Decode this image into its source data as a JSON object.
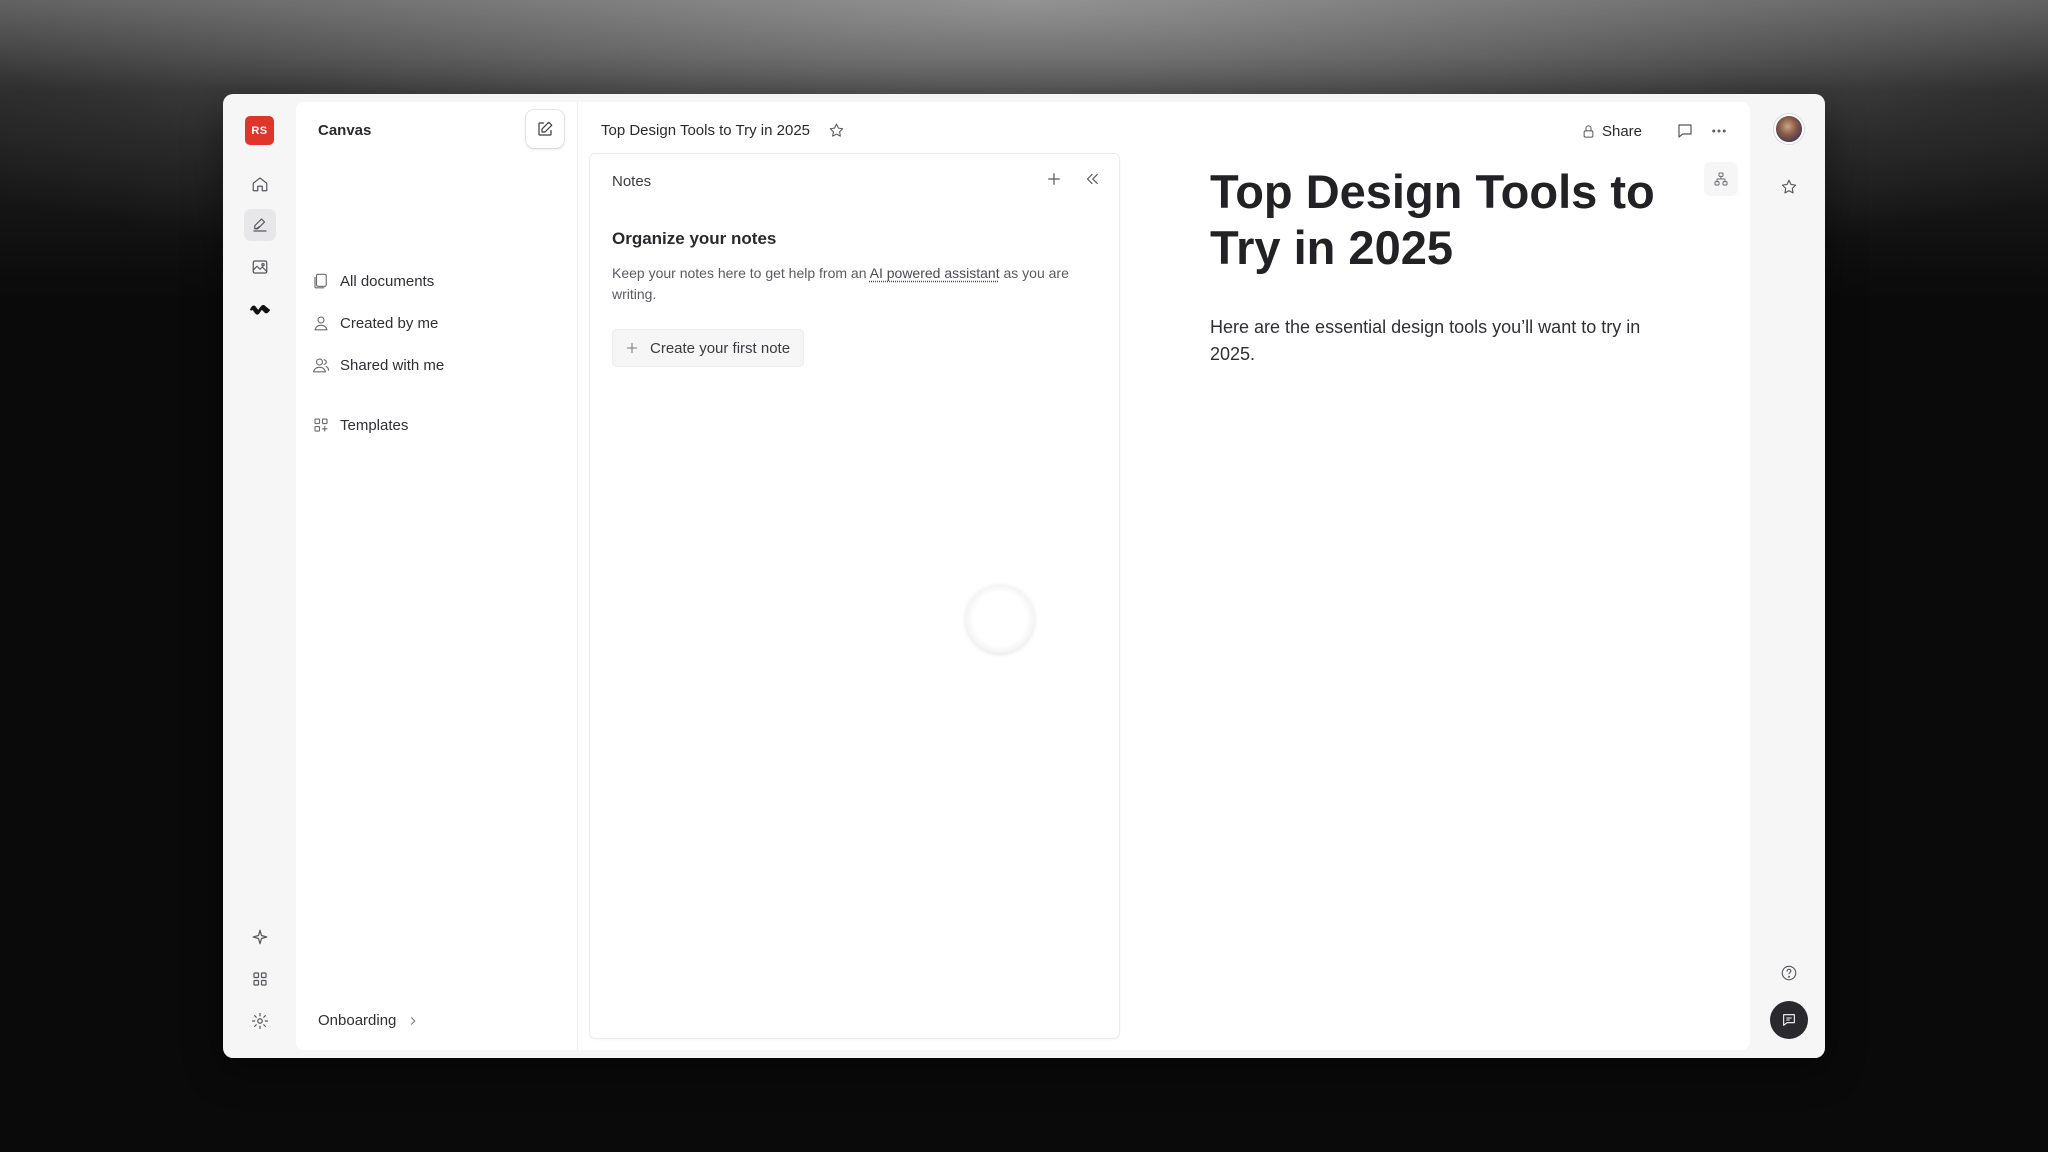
{
  "rail": {
    "badge": "RS",
    "icons": [
      "home-icon",
      "canvas-icon",
      "image-icon",
      "brand-logo-icon",
      "sparkle-icon",
      "apps-grid-icon",
      "settings-gear-icon"
    ]
  },
  "sidebar": {
    "title": "Canvas",
    "items": [
      {
        "label": "All documents",
        "icon": "documents-icon"
      },
      {
        "label": "Created by me",
        "icon": "person-icon"
      },
      {
        "label": "Shared with me",
        "icon": "people-icon"
      },
      {
        "label": "Templates",
        "icon": "templates-grid-icon"
      }
    ],
    "footer": {
      "label": "Onboarding"
    }
  },
  "topbar": {
    "doc_title": "Top Design Tools to Try in 2025",
    "share_label": "Share"
  },
  "notes": {
    "label": "Notes",
    "heading": "Organize your notes",
    "body_prefix": "Keep your notes here to get help from an ",
    "body_link": "AI powered assistant",
    "body_suffix": " as you are writing.",
    "create_label": "Create your first note"
  },
  "document": {
    "heading": "Top Design Tools to Try in 2025",
    "paragraph": "Here are the essential design tools you’ll want to try in 2025."
  },
  "colors": {
    "accent_badge": "#e0352b",
    "fab": "#2a2a2e",
    "window_bg": "#f6f6f7"
  }
}
